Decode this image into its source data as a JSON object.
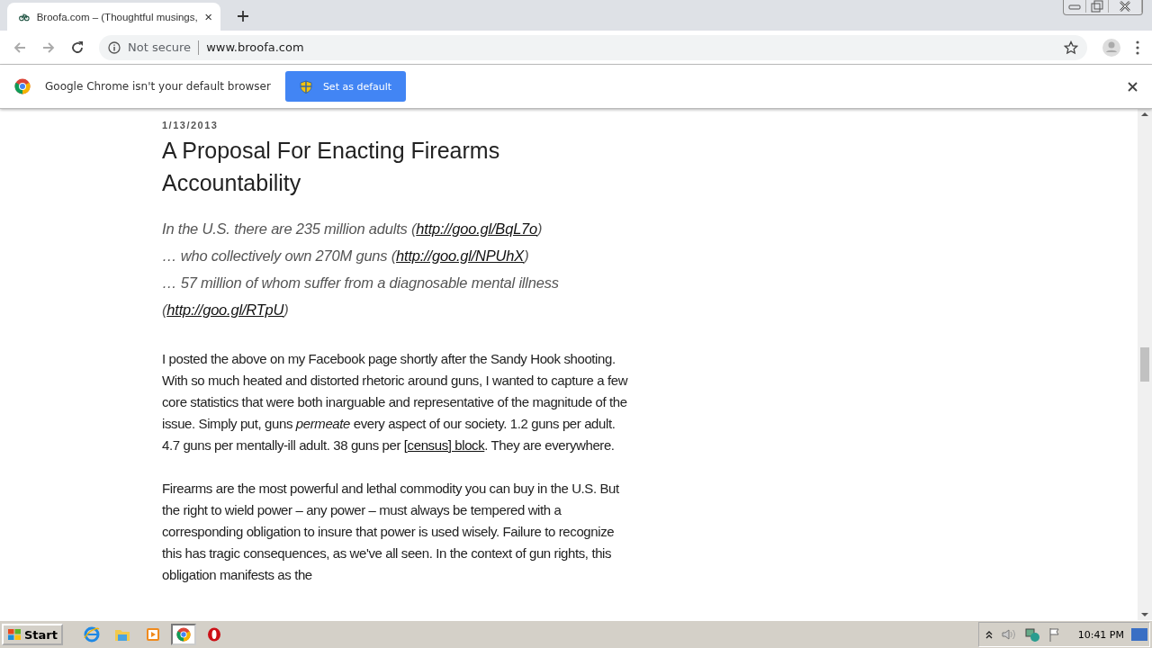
{
  "tab": {
    "title": "Broofa.com – (Thoughtful musings,",
    "selected": true
  },
  "toolbar": {
    "security": "Not secure",
    "url": "www.broofa.com"
  },
  "infobar": {
    "message": "Google Chrome isn't your default browser",
    "button": "Set as default"
  },
  "post": {
    "date": "1/13/2013",
    "title": "A Proposal For Enacting Firearms Accountability",
    "quote": [
      {
        "before": "In the U.S. there are 235 million adults (",
        "link": "http://goo.gl/BqL7o",
        "after": ")"
      },
      {
        "before": "… who collectively own 270M guns (",
        "link": "http://goo.gl/NPUhX",
        "after": ")"
      },
      {
        "before": "… 57 million of whom suffer from a diagnosable mental illness (",
        "link": "http://goo.gl/RTpU",
        "after": ")"
      }
    ],
    "paragraphs": [
      [
        {
          "kind": "text",
          "text": "I posted the above on my Facebook page shortly after the Sandy Hook shooting. With so much heated and distorted rhetoric around guns, I wanted to capture a few core statistics that were both inarguable and representative of the magnitude of the issue.  Simply put, guns *permeate* every aspect of our society. 1.2 guns per adult. 4.7 guns per mentally-ill adult. 38 guns per "
        },
        {
          "kind": "link",
          "text": "[census] block"
        },
        {
          "kind": "text",
          "text": ".  They are everywhere."
        }
      ],
      [
        {
          "kind": "text",
          "text": "Firearms are the most powerful and lethal commodity you can buy in the U.S.  But the right to wield power – any power – must always be tempered with a corresponding obligation to insure that power is used wisely.  Failure to recognize this has tragic consequences, as we've all seen.  In the context of gun rights, this obligation manifests as the"
        }
      ]
    ]
  },
  "taskbar": {
    "start": "Start",
    "apps": [
      {
        "kind": "ie",
        "selected": false
      },
      {
        "kind": "folder",
        "selected": false
      },
      {
        "kind": "media",
        "selected": false
      },
      {
        "kind": "chrome",
        "selected": true
      },
      {
        "kind": "opera",
        "selected": false
      }
    ],
    "clock": "10:41 PM"
  }
}
